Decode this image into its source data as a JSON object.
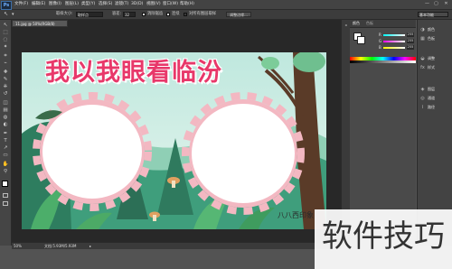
{
  "app": {
    "logo": "Ps"
  },
  "menubar": {
    "items": [
      "文件(F)",
      "编辑(E)",
      "图像(I)",
      "图层(L)",
      "类型(Y)",
      "选择(S)",
      "滤镜(T)",
      "3D(D)",
      "视图(V)",
      "窗口(W)",
      "帮助(H)"
    ],
    "minimize": "—",
    "maximize": "▢",
    "close": "✕"
  },
  "options": {
    "tool_icon": "move-tool-icon",
    "sample_size_label": "取样大小:",
    "sample_size_value": "取样点",
    "tolerance_label": "容差:",
    "tolerance_value": "32",
    "antialias_label": "消除锯齿",
    "contiguous_label": "连续",
    "all_layers_label": "对所有图层取样",
    "refine_edge_label": "调整边缘...",
    "workspace": "基本功能"
  },
  "toolbar": {
    "icons": [
      "move-tool-icon",
      "marquee-tool-icon",
      "lasso-tool-icon",
      "magic-wand-icon",
      "crop-tool-icon",
      "eyedropper-icon",
      "healing-brush-icon",
      "brush-icon",
      "clone-stamp-icon",
      "history-brush-icon",
      "eraser-icon",
      "gradient-icon",
      "blur-icon",
      "dodge-icon",
      "pen-icon",
      "type-icon",
      "path-select-icon",
      "shape-icon",
      "hand-icon",
      "zoom-icon"
    ],
    "glyphs": [
      "↖",
      "⬚",
      "◌",
      "✦",
      "⌗",
      "⌁",
      "✚",
      "✎",
      "⎈",
      "↺",
      "◫",
      "▤",
      "◍",
      "◐",
      "✒",
      "T",
      "↗",
      "▭",
      "✋",
      "⚲"
    ]
  },
  "document": {
    "tab_title": "11.jpg @ 50%(RGB/8)",
    "canvas_title": "我以我眼看临汾",
    "signature": "八八西印象"
  },
  "status": {
    "zoom": "50%",
    "doc_size": "文档:5.93M/5.93M"
  },
  "panels": {
    "color_tab": "颜色",
    "swatches_tab": "色板",
    "sliders": [
      {
        "label": "R",
        "value": "255"
      },
      {
        "label": "G",
        "value": "255"
      },
      {
        "label": "B",
        "value": "255"
      }
    ]
  },
  "right_dock": {
    "items": [
      {
        "icon": "color-panel-icon",
        "glyph": "◑",
        "label": "颜色"
      },
      {
        "icon": "swatches-panel-icon",
        "glyph": "▦",
        "label": "色板"
      },
      {
        "icon": "adjustments-panel-icon",
        "glyph": "◒",
        "label": "调整"
      },
      {
        "icon": "styles-panel-icon",
        "glyph": "fx",
        "label": "样式"
      },
      {
        "icon": "layers-panel-icon",
        "glyph": "◈",
        "label": "图层"
      },
      {
        "icon": "channels-panel-icon",
        "glyph": "◎",
        "label": "通道"
      },
      {
        "icon": "paths-panel-icon",
        "glyph": "⌇",
        "label": "路径"
      }
    ]
  },
  "watermark": {
    "text": "软件技巧"
  }
}
